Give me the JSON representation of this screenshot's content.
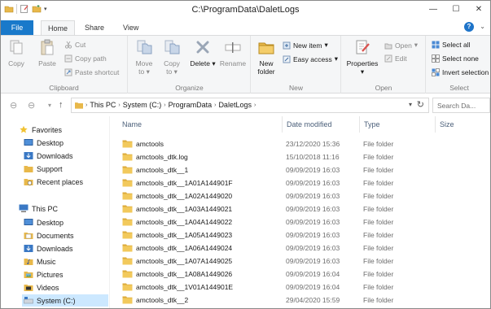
{
  "window": {
    "title": "C:\\ProgramData\\DaletLogs",
    "minimize": "—",
    "maximize": "☐",
    "close": "✕"
  },
  "tabs": {
    "file": "File",
    "home": "Home",
    "share": "Share",
    "view": "View",
    "help": "?"
  },
  "ribbon": {
    "clipboard": {
      "label": "Clipboard",
      "copy": "Copy",
      "paste": "Paste",
      "cut": "Cut",
      "copy_path": "Copy path",
      "paste_shortcut": "Paste shortcut"
    },
    "organize": {
      "label": "Organize",
      "move_to": "Move",
      "move_to_2": "to",
      "copy_to": "Copy",
      "copy_to_2": "to",
      "delete": "Delete",
      "rename": "Rename"
    },
    "new": {
      "label": "New",
      "new_folder": "New",
      "new_folder_2": "folder",
      "new_item": "New item",
      "easy_access": "Easy access"
    },
    "open": {
      "label": "Open",
      "properties": "Properties",
      "open": "Open",
      "edit": "Edit"
    },
    "select": {
      "label": "Select",
      "select_all": "Select all",
      "select_none": "Select none",
      "invert": "Invert selection"
    }
  },
  "address": {
    "crumbs": [
      "This PC",
      "System (C:)",
      "ProgramData",
      "DaletLogs"
    ],
    "search_placeholder": "Search Da..."
  },
  "nav": {
    "favorites": "Favorites",
    "fav_items": [
      "Desktop",
      "Downloads",
      "Support",
      "Recent places"
    ],
    "this_pc": "This PC",
    "pc_items": [
      "Desktop",
      "Documents",
      "Downloads",
      "Music",
      "Pictures",
      "Videos",
      "System (C:)"
    ]
  },
  "columns": {
    "name": "Name",
    "date": "Date modified",
    "type": "Type",
    "size": "Size"
  },
  "files": [
    {
      "name": "amctools",
      "date": "23/12/2020 15:36",
      "type": "File folder"
    },
    {
      "name": "amctools_dtk.log",
      "date": "15/10/2018 11:16",
      "type": "File folder"
    },
    {
      "name": "amctools_dtk__1",
      "date": "09/09/2019 16:03",
      "type": "File folder"
    },
    {
      "name": "amctools_dtk__1A01A144901F",
      "date": "09/09/2019 16:03",
      "type": "File folder"
    },
    {
      "name": "amctools_dtk__1A02A1449020",
      "date": "09/09/2019 16:03",
      "type": "File folder"
    },
    {
      "name": "amctools_dtk__1A03A1449021",
      "date": "09/09/2019 16:03",
      "type": "File folder"
    },
    {
      "name": "amctools_dtk__1A04A1449022",
      "date": "09/09/2019 16:03",
      "type": "File folder"
    },
    {
      "name": "amctools_dtk__1A05A1449023",
      "date": "09/09/2019 16:03",
      "type": "File folder"
    },
    {
      "name": "amctools_dtk__1A06A1449024",
      "date": "09/09/2019 16:03",
      "type": "File folder"
    },
    {
      "name": "amctools_dtk__1A07A1449025",
      "date": "09/09/2019 16:03",
      "type": "File folder"
    },
    {
      "name": "amctools_dtk__1A08A1449026",
      "date": "09/09/2019 16:04",
      "type": "File folder"
    },
    {
      "name": "amctools_dtk__1V01A144901E",
      "date": "09/09/2019 16:04",
      "type": "File folder"
    },
    {
      "name": "amctools_dtk__2",
      "date": "29/04/2020 15:59",
      "type": "File folder"
    }
  ],
  "colors": {
    "accent": "#1979ca",
    "folder": "#e8b84a",
    "selection": "#cce8ff"
  }
}
